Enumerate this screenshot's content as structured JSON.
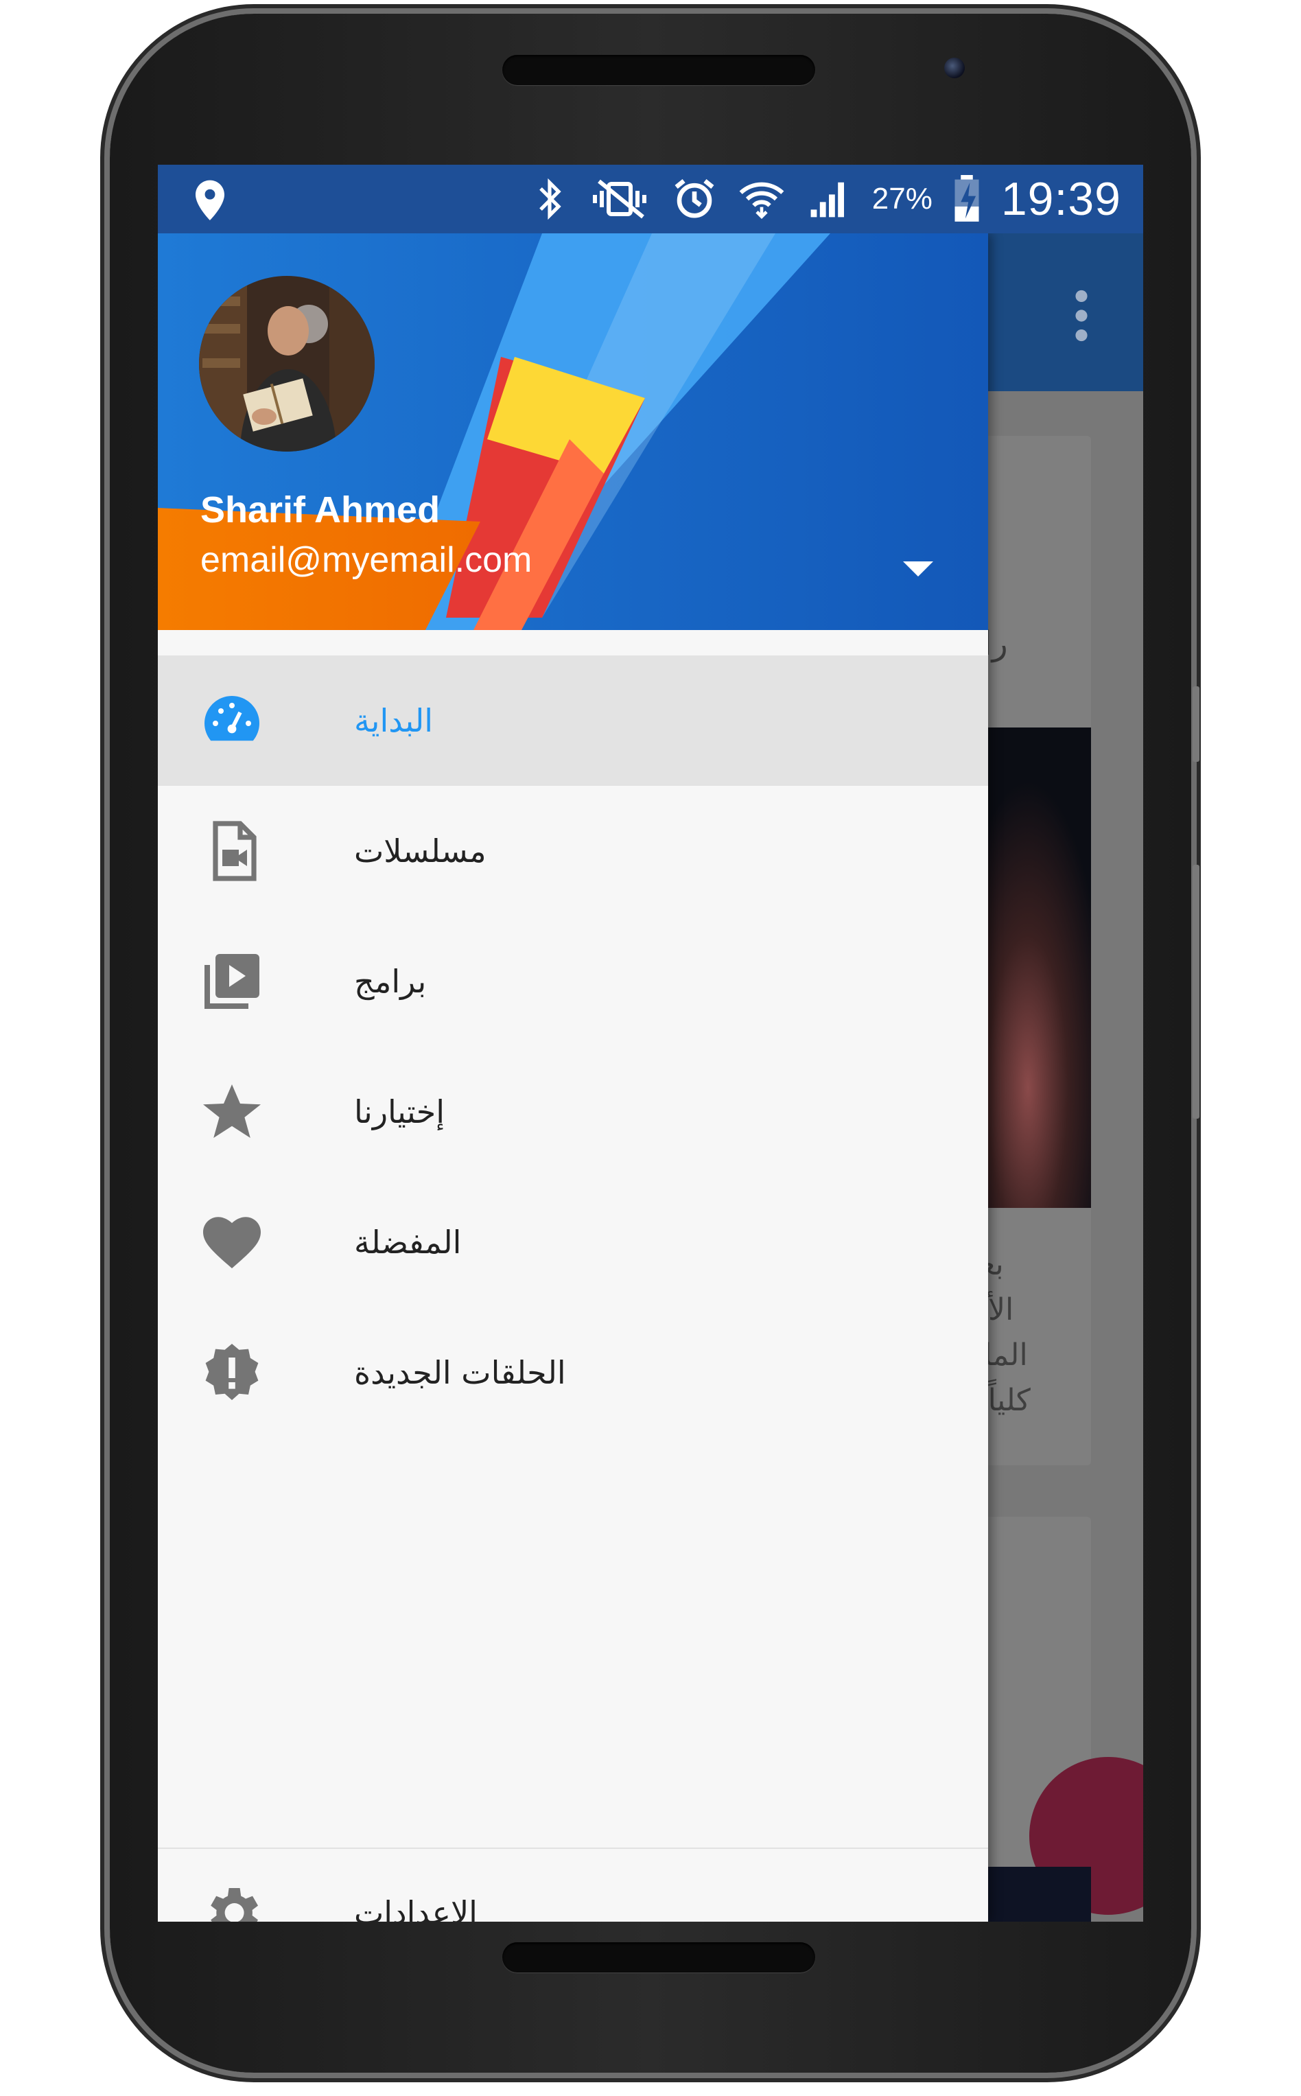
{
  "status_bar": {
    "battery_percent": "27%",
    "time": "19:39",
    "icons": [
      "location-icon",
      "bluetooth-icon",
      "vibrate-icon",
      "alarm-icon",
      "wifi-icon",
      "signal-icon",
      "battery-charging-icon"
    ]
  },
  "drawer": {
    "user": {
      "name": "Sharif Ahmed",
      "email": "email@myemail.com"
    },
    "items": [
      {
        "label": "البداية",
        "icon": "speedometer-icon",
        "active": true
      },
      {
        "label": "مسلسلات",
        "icon": "video-file-icon",
        "active": false
      },
      {
        "label": "برامج",
        "icon": "video-library-icon",
        "active": false
      },
      {
        "label": "إختيارنا",
        "icon": "star-icon",
        "active": false
      },
      {
        "label": "المفضلة",
        "icon": "heart-icon",
        "active": false
      },
      {
        "label": "الحلقات الجديدة",
        "icon": "alert-badge-icon",
        "active": false
      }
    ],
    "settings_label": "الإعدادات"
  },
  "background_app": {
    "card_title": "رامز",
    "card_text": [
      "بعد أ",
      "الأسد",
      "الماض",
      "كلياً ف"
    ]
  },
  "colors": {
    "status_bar": "#1e4f97",
    "header_blue": "#1565c0",
    "accent": "#2196f3",
    "icon_grey": "#757575"
  }
}
